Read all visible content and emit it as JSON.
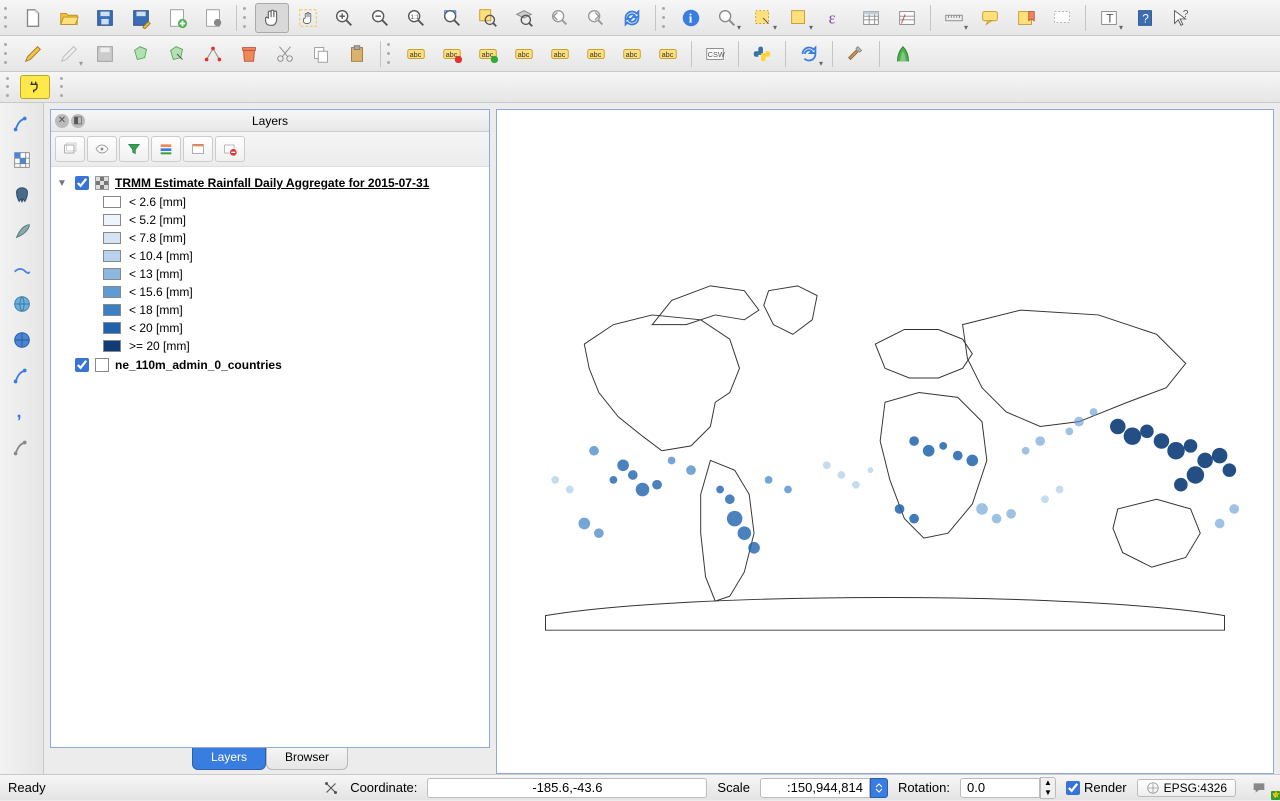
{
  "panel": {
    "title": "Layers",
    "tabs": {
      "layers": "Layers",
      "browser": "Browser",
      "active": "layers"
    }
  },
  "layers": {
    "raster": {
      "name": "TRMM Estimate Rainfall Daily Aggregate for 2015-07-31",
      "visible": true,
      "expanded": true,
      "legend": [
        {
          "label": "< 2.6 [mm]",
          "color": "#ffffff"
        },
        {
          "label": "< 5.2 [mm]",
          "color": "#eef4fb"
        },
        {
          "label": "< 7.8 [mm]",
          "color": "#d6e4f2"
        },
        {
          "label": "< 10.4 [mm]",
          "color": "#b7d2ea"
        },
        {
          "label": "< 13 [mm]",
          "color": "#8cb8df"
        },
        {
          "label": "< 15.6 [mm]",
          "color": "#5f9bd3"
        },
        {
          "label": "< 18 [mm]",
          "color": "#3b7fc4"
        },
        {
          "label": "< 20 [mm]",
          "color": "#1f63ad"
        },
        {
          "label": ">= 20 [mm]",
          "color": "#0d3c78"
        }
      ]
    },
    "vector": {
      "name": "ne_110m_admin_0_countries",
      "visible": true
    }
  },
  "statusbar": {
    "ready": "Ready",
    "coordinate_label": "Coordinate:",
    "coordinate_value": "-185.6,-43.6",
    "scale_label": "Scale",
    "scale_value": ":150,944,814",
    "rotation_label": "Rotation:",
    "rotation_value": "0.0",
    "render_label": "Render",
    "render_checked": true,
    "crs": "EPSG:4326"
  },
  "toolbar_icons": {
    "row1": [
      "new-project",
      "open-project",
      "save-project",
      "save-project-as",
      "new-print-composer",
      "composer-manager",
      "pan",
      "pan-to-selection",
      "zoom-in",
      "zoom-out",
      "zoom-native",
      "zoom-full",
      "zoom-to-selection",
      "zoom-to-layer",
      "zoom-last",
      "zoom-next",
      "refresh",
      "identify",
      "measure",
      "select-rect",
      "select-expression",
      "expression",
      "open-attribute-table",
      "field-calculator",
      "statistics",
      "map-tips",
      "bookmark",
      "text-annotation",
      "question",
      "pointer-whats-this"
    ],
    "row2": [
      "digitize-pencil",
      "digitize-segment",
      "save-layer-edits",
      "add-feature-polygon",
      "add-feature-layer",
      "node-tool",
      "delete",
      "cut",
      "copy",
      "paste",
      "label-abc",
      "label-pin-yellow",
      "label-pin-green",
      "label-move",
      "label-rotate",
      "label-show",
      "label-hide",
      "label-change",
      "csw",
      "python",
      "reload",
      "build",
      "grass"
    ],
    "left": [
      "add-vector",
      "add-raster",
      "add-postgis",
      "add-spatialite",
      "add-mssql",
      "add-wms",
      "add-wfs",
      "add-delimited",
      "add-virtual",
      "new-shapefile"
    ]
  }
}
